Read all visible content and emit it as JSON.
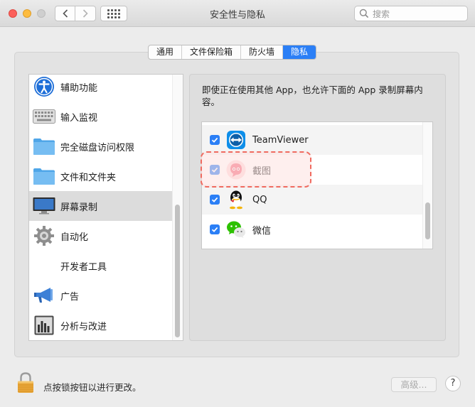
{
  "window": {
    "title": "安全性与隐私",
    "search_placeholder": "搜索"
  },
  "tabs": [
    {
      "label": "通用",
      "active": false
    },
    {
      "label": "文件保险箱",
      "active": false
    },
    {
      "label": "防火墙",
      "active": false
    },
    {
      "label": "隐私",
      "active": true
    }
  ],
  "sidebar": {
    "items": [
      {
        "label": "辅助功能",
        "icon": "accessibility-icon"
      },
      {
        "label": "输入监视",
        "icon": "keyboard-icon"
      },
      {
        "label": "完全磁盘访问权限",
        "icon": "folder-icon"
      },
      {
        "label": "文件和文件夹",
        "icon": "folder-icon"
      },
      {
        "label": "屏幕录制",
        "icon": "display-icon",
        "selected": true
      },
      {
        "label": "自动化",
        "icon": "gear-icon"
      },
      {
        "label": "开发者工具",
        "icon": ""
      },
      {
        "label": "广告",
        "icon": "megaphone-icon"
      },
      {
        "label": "分析与改进",
        "icon": "chart-icon"
      }
    ]
  },
  "main": {
    "description": "即使正在使用其他 App，也允许下面的 App 录制屏幕内容。",
    "apps": [
      {
        "label": "TeamViewer",
        "checked": true,
        "icon": "teamviewer-icon"
      },
      {
        "label": "截图",
        "checked": true,
        "icon": "screenshot-app-icon"
      },
      {
        "label": "QQ",
        "checked": true,
        "icon": "qq-icon"
      },
      {
        "label": "微信",
        "checked": true,
        "icon": "wechat-icon"
      }
    ]
  },
  "footer": {
    "lock_text": "点按锁按钮以进行更改。",
    "advanced_label": "高级...",
    "help_label": "?"
  },
  "colors": {
    "accent": "#2b7ff6",
    "highlight_border": "#f06a5f",
    "highlight_fill": "#fde2e0"
  }
}
